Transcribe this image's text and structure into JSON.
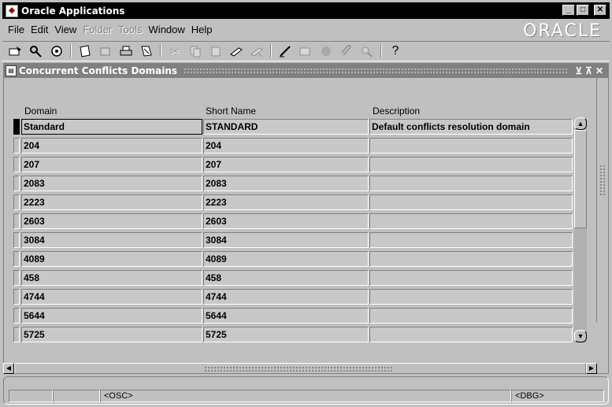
{
  "window": {
    "title": "Oracle Applications",
    "minimize": "_",
    "maximize": "□",
    "close": "✕"
  },
  "menu": [
    "File",
    "Edit",
    "View",
    "Folder",
    "Tools",
    "Window",
    "Help"
  ],
  "menu_disabled": [
    "Folder",
    "Tools"
  ],
  "brand": "ORACLE",
  "toolbar": {
    "icons": [
      "new-record-icon",
      "find-icon",
      "navigator-icon",
      "save-icon",
      "next-step-icon",
      "print-icon",
      "close-form-icon",
      "cut-icon",
      "copy-icon",
      "paste-icon",
      "new-record-icon",
      "delete-record-icon",
      "edit-field-icon",
      "zoom-icon",
      "translations-icon",
      "attachments-icon",
      "folder-tools-icon",
      "help-icon"
    ],
    "help_label": "?"
  },
  "form": {
    "title": "Concurrent Conflicts Domains",
    "columns": {
      "domain": "Domain",
      "short_name": "Short Name",
      "description": "Description"
    },
    "rows": [
      {
        "domain": "Standard",
        "short_name": "STANDARD",
        "description": "Default conflicts resolution domain"
      },
      {
        "domain": "204",
        "short_name": "204",
        "description": ""
      },
      {
        "domain": "207",
        "short_name": "207",
        "description": ""
      },
      {
        "domain": "2083",
        "short_name": "2083",
        "description": ""
      },
      {
        "domain": "2223",
        "short_name": "2223",
        "description": ""
      },
      {
        "domain": "2603",
        "short_name": "2603",
        "description": ""
      },
      {
        "domain": "3084",
        "short_name": "3084",
        "description": ""
      },
      {
        "domain": "4089",
        "short_name": "4089",
        "description": ""
      },
      {
        "domain": "458",
        "short_name": "458",
        "description": ""
      },
      {
        "domain": "4744",
        "short_name": "4744",
        "description": ""
      },
      {
        "domain": "5644",
        "short_name": "5644",
        "description": ""
      },
      {
        "domain": "5725",
        "short_name": "5725",
        "description": ""
      }
    ]
  },
  "status": {
    "osc": "<OSC>",
    "dbg": "<DBG>"
  }
}
